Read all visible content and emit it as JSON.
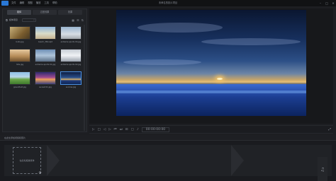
{
  "window": {
    "title": "未命名的影片项目",
    "menu": [
      "文件",
      "编辑",
      "视图",
      "播放",
      "工具",
      "帮助"
    ],
    "controls": [
      "–",
      "□",
      "✕"
    ]
  },
  "tabs": [
    {
      "label": "媒体",
      "active": true
    },
    {
      "label": "过渡效果",
      "active": false
    },
    {
      "label": "效果",
      "active": false
    }
  ],
  "library": {
    "label": "媒体项目",
    "search_icon": "search-icon"
  },
  "thumbnails": [
    {
      "label": "bulls.jpg",
      "selected": false
    },
    {
      "label": "beach_3Shuiqit",
      "selected": false
    },
    {
      "label": "extreme sports 04.jpg",
      "selected": false
    },
    {
      "label": "hills.jpg",
      "selected": false
    },
    {
      "label": "extreme sports 01.jpg",
      "selected": false
    },
    {
      "label": "extreme sports 02.jpg",
      "selected": false
    },
    {
      "label": "greenfield.jpg",
      "selected": false
    },
    {
      "label": "sunset 01.jpg",
      "selected": false
    },
    {
      "label": "sunrise.jpg",
      "selected": true
    }
  ],
  "bottom": {
    "header": "在此处添加视频和照片",
    "slot_text": "在此处拖放媒体"
  },
  "timecode": "00:00:00:00"
}
